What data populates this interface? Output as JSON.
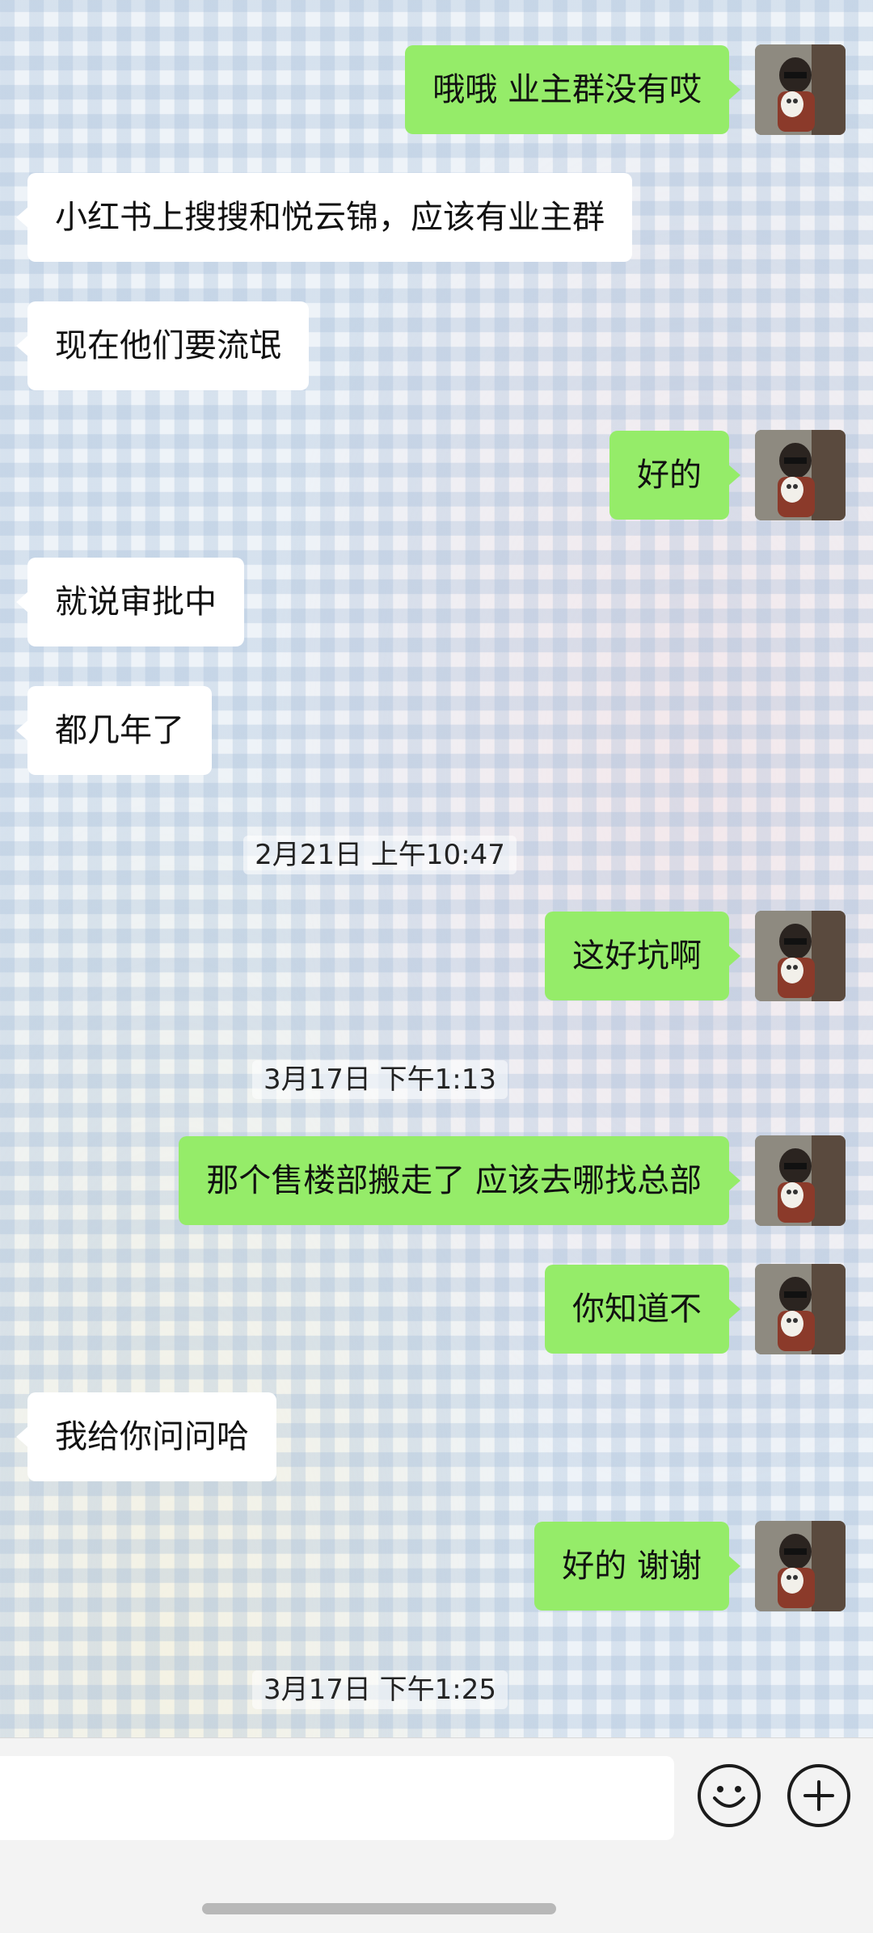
{
  "messages": [
    {
      "side": "me",
      "text": "哦哦 业主群没有哎"
    },
    {
      "side": "them",
      "text": "小红书上搜搜和悦云锦，应该有业主群"
    },
    {
      "side": "them",
      "text": "现在他们要流氓"
    },
    {
      "side": "me",
      "text": "好的"
    },
    {
      "side": "them",
      "text": "就说审批中"
    },
    {
      "side": "them",
      "text": "都几年了"
    },
    {
      "side": "time",
      "text": "2月21日 上午10:47"
    },
    {
      "side": "me",
      "text": "这好坑啊"
    },
    {
      "side": "time",
      "text": "3月17日 下午1:13"
    },
    {
      "side": "me",
      "text": "那个售楼部搬走了 应该去哪找总部"
    },
    {
      "side": "me",
      "text": "你知道不"
    },
    {
      "side": "them",
      "text": "我给你问问哈"
    },
    {
      "side": "me",
      "text": "好的 谢谢"
    },
    {
      "side": "time",
      "text": "3月17日 下午1:25"
    }
  ],
  "input": {
    "value": "",
    "placeholder": ""
  },
  "icons": {
    "emoji": "smiley-face-icon",
    "more": "plus-circle-icon"
  },
  "colors": {
    "my_bubble": "#95ec69",
    "their_bubble": "#ffffff",
    "input_bar": "#f3f3f3"
  }
}
